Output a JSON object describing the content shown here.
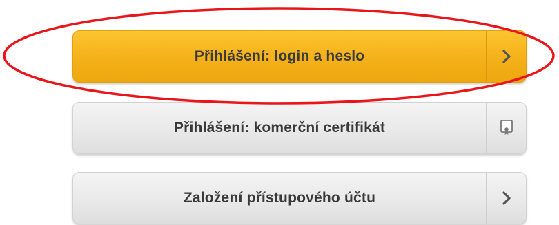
{
  "buttons": {
    "login": {
      "label": "Přihlášení: login a heslo",
      "icon": "chevron-right-icon"
    },
    "certificate": {
      "label": "Přihlášení: komerční certifikát",
      "icon": "certificate-icon"
    },
    "account": {
      "label": "Založení přístupového účtu",
      "icon": "chevron-right-icon"
    }
  },
  "highlight": {
    "color": "#e8161b"
  },
  "colors": {
    "primary": "#f5b21b",
    "secondary": "#e9e9e9",
    "text": "#3a3a3a"
  }
}
